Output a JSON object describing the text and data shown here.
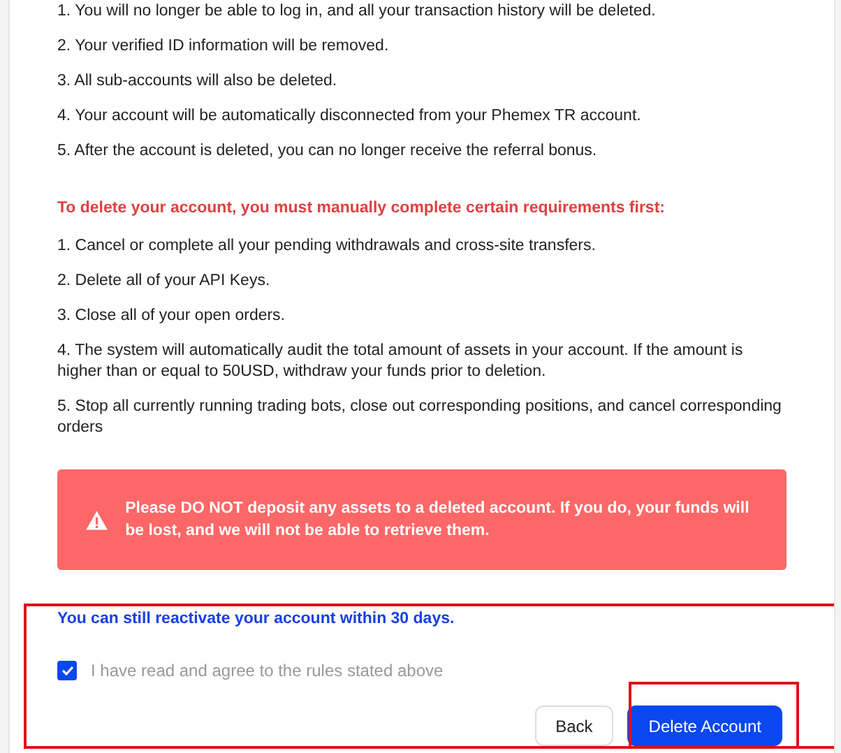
{
  "consequences": [
    "1. You will no longer be able to log in, and all your transaction history will be deleted.",
    "2. Your verified ID information will be removed.",
    "3. All sub-accounts will also be deleted.",
    "4. Your account will be automatically disconnected from your Phemex TR account.",
    "5. After the account is deleted, you can no longer receive the referral bonus."
  ],
  "requirements_heading": "To delete your account, you must manually complete certain requirements first:",
  "requirements": [
    "1. Cancel or complete all your pending withdrawals and cross-site transfers.",
    "2. Delete all of your API Keys.",
    "3. Close all of your open orders.",
    "4. The system will automatically audit the total amount of assets in your account. If the amount is higher than or equal to 50USD, withdraw your funds prior to deletion.",
    "5. Stop all currently running trading bots, close out corresponding positions, and cancel corresponding orders"
  ],
  "warning": "Please DO NOT deposit any assets to a deleted account. If you do, your funds will be lost, and we will not be able to retrieve them.",
  "reactivate_note": "You can still reactivate your account within 30 days.",
  "agreement": {
    "label": "I have read and agree to the rules stated above",
    "checked": true
  },
  "buttons": [
    {
      "label": "Back",
      "kind": "secondary"
    },
    {
      "label": "Delete Account",
      "kind": "primary"
    }
  ]
}
